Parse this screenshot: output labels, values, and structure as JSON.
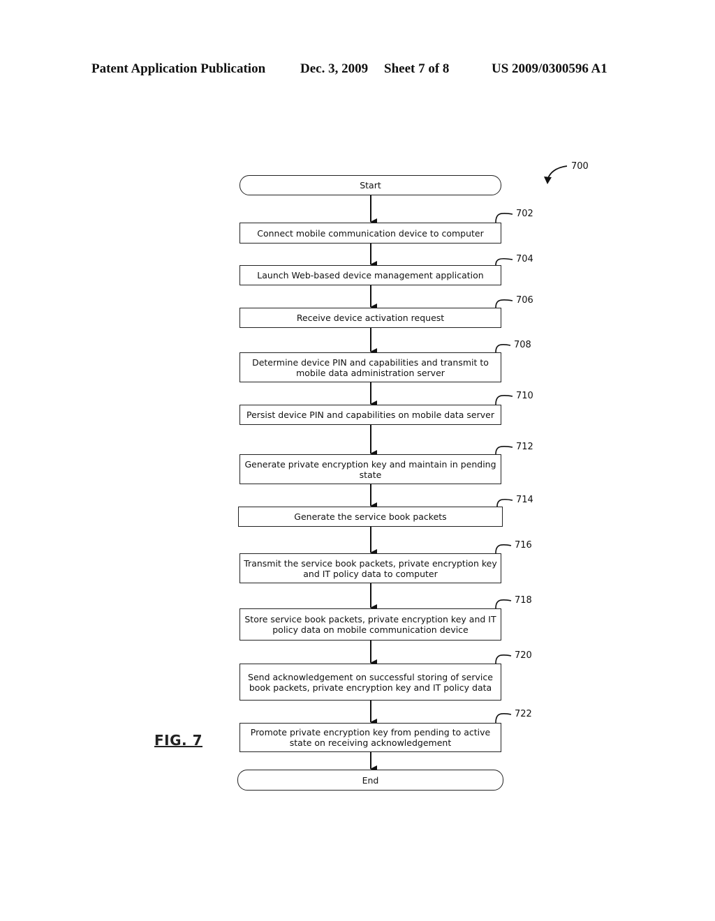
{
  "header": {
    "publication_type": "Patent Application Publication",
    "date": "Dec. 3, 2009",
    "sheet": "Sheet 7 of 8",
    "publication_number": "US 2009/0300596 A1"
  },
  "figure": {
    "label": "FIG. 7",
    "reference": "700"
  },
  "flowchart": {
    "start": "Start",
    "end": "End",
    "steps": [
      {
        "ref": "702",
        "text": "Connect mobile communication device to computer"
      },
      {
        "ref": "704",
        "text": "Launch Web-based device management application"
      },
      {
        "ref": "706",
        "text": "Receive device activation request"
      },
      {
        "ref": "708",
        "text": "Determine device PIN and capabilities and transmit to mobile data administration server"
      },
      {
        "ref": "710",
        "text": "Persist device PIN and capabilities on mobile data server"
      },
      {
        "ref": "712",
        "text": "Generate private encryption key and maintain in pending state"
      },
      {
        "ref": "714",
        "text": "Generate the service book packets"
      },
      {
        "ref": "716",
        "text": "Transmit the service book packets, private encryption key and IT policy data to computer"
      },
      {
        "ref": "718",
        "text": "Store service book packets, private encryption key and IT policy data on mobile communication device"
      },
      {
        "ref": "720",
        "text": "Send acknowledgement on successful storing of service book packets, private encryption key and IT policy data"
      },
      {
        "ref": "722",
        "text": "Promote private encryption key from pending to active state on receiving acknowledgement"
      }
    ]
  }
}
